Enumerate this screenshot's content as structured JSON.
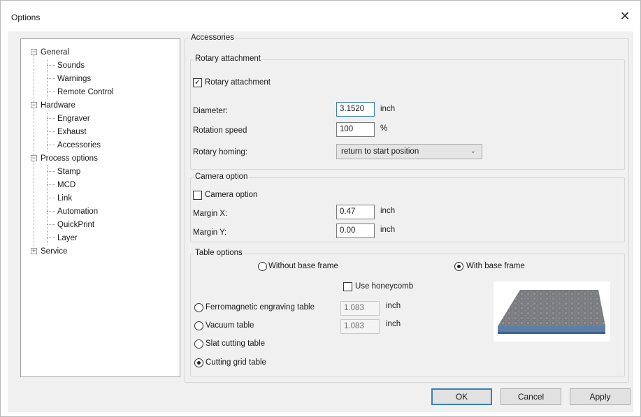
{
  "window": {
    "title": "Options",
    "close_glyph": "✕"
  },
  "tree": {
    "expander_collapsed": "−",
    "expander_expanded": "+",
    "items": [
      {
        "label": "General"
      },
      {
        "label": "Sounds"
      },
      {
        "label": "Warnings"
      },
      {
        "label": "Remote Control"
      },
      {
        "label": "Hardware"
      },
      {
        "label": "Engraver"
      },
      {
        "label": "Exhaust"
      },
      {
        "label": "Accessories",
        "selected": true
      },
      {
        "label": "Process options"
      },
      {
        "label": "Stamp"
      },
      {
        "label": "MCD"
      },
      {
        "label": "Link"
      },
      {
        "label": "Automation"
      },
      {
        "label": "QuickPrint"
      },
      {
        "label": "Layer"
      },
      {
        "label": "Service"
      }
    ]
  },
  "panel": {
    "title": "Accessories",
    "rotary": {
      "group_label": "Rotary attachment",
      "checkbox_label": "Rotary attachment",
      "checkbox_checked": true,
      "check_glyph": "✓",
      "diameter_label": "Diameter:",
      "diameter_value": "3.1520",
      "diameter_unit": "inch",
      "speed_label": "Rotation speed",
      "speed_value": "100",
      "speed_unit": "%",
      "homing_label": "Rotary homing:",
      "homing_value": "return to start position",
      "chevron_glyph": "⌄"
    },
    "camera": {
      "group_label": "Camera option",
      "checkbox_label": "Camera option",
      "checkbox_checked": false,
      "margin_x_label": "Margin X:",
      "margin_x_value": "0.47",
      "margin_x_unit": "inch",
      "margin_y_label": "Margin Y:",
      "margin_y_value": "0.00",
      "margin_y_unit": "inch"
    },
    "table": {
      "group_label": "Table options",
      "without_base_frame": "Without base frame",
      "with_base_frame": "With base frame",
      "base_frame_selected": "with",
      "honeycomb_label": "Use honeycomb",
      "honeycomb_checked": false,
      "ferromagnetic_label": "Ferromagnetic engraving table",
      "ferromagnetic_value": "1.083",
      "ferromagnetic_unit": "inch",
      "vacuum_label": "Vacuum table",
      "vacuum_value": "1.083",
      "vacuum_unit": "inch",
      "slat_label": "Slat cutting table",
      "grid_label": "Cutting grid table",
      "selected_table": "grid"
    }
  },
  "buttons": {
    "ok": "OK",
    "cancel": "Cancel",
    "apply": "Apply"
  },
  "colors": {
    "accent": "#3c7fb1",
    "table_top": "#7f8185",
    "table_edge": "#5b7fa6"
  }
}
